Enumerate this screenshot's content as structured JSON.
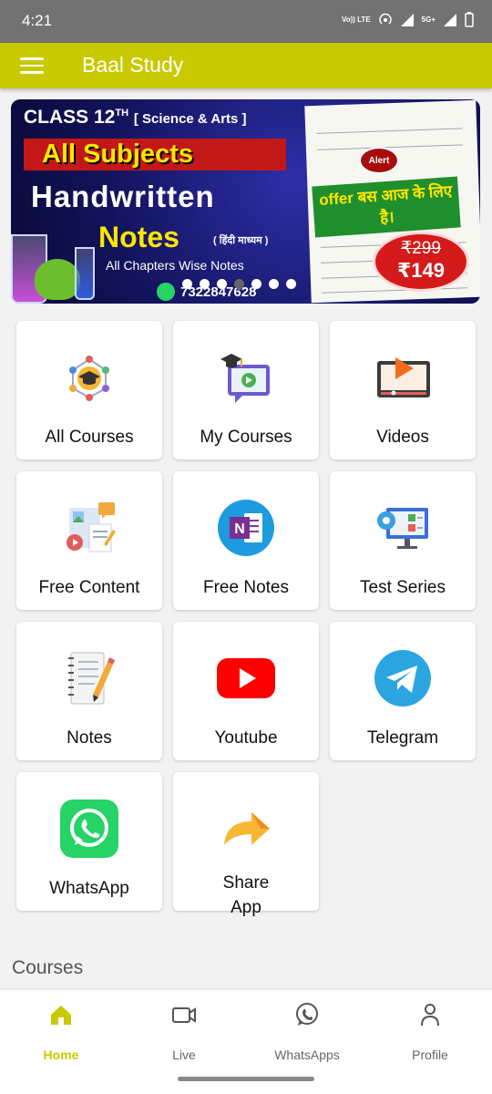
{
  "status_bar": {
    "time": "4:21",
    "volte": "Vo)) LTE",
    "network": "5G+"
  },
  "app_bar": {
    "title": "Baal Study"
  },
  "banner": {
    "class_text": "CLASS 12",
    "class_sup": "TH",
    "stream": "[ Science & Arts ]",
    "headline1": "All Subjects",
    "headline2": "Handwritten",
    "headline3": "Notes",
    "medium": "( हिंदी माध्यम )",
    "chapters": "All Chapters Wise Notes",
    "phone": "7322847628",
    "alert": "Alert",
    "offer": "offer बस आज के लिए है।",
    "old_price": "₹299",
    "new_price": "₹149",
    "dot_count": 7,
    "active_dot": 3
  },
  "tiles": [
    {
      "label": "All Courses",
      "icon": "graduation-network-icon"
    },
    {
      "label": "My Courses",
      "icon": "video-lesson-icon"
    },
    {
      "label": "Videos",
      "icon": "video-player-icon"
    },
    {
      "label": "Free Content",
      "icon": "media-content-icon"
    },
    {
      "label": "Free Notes",
      "icon": "onenote-icon"
    },
    {
      "label": "Test Series",
      "icon": "monitor-test-icon"
    },
    {
      "label": "Notes",
      "icon": "notebook-pencil-icon"
    },
    {
      "label": "Youtube",
      "icon": "youtube-icon"
    },
    {
      "label": "Telegram",
      "icon": "telegram-icon"
    },
    {
      "label": "WhatsApp",
      "icon": "whatsapp-icon"
    },
    {
      "label": "Share\nApp",
      "icon": "share-arrow-icon"
    }
  ],
  "section_title": "Courses",
  "bottom_nav": [
    {
      "label": "Home",
      "icon": "home-icon",
      "active": true
    },
    {
      "label": "Live",
      "icon": "video-camera-icon",
      "active": false
    },
    {
      "label": "WhatsApps",
      "icon": "whatsapp-icon",
      "active": false
    },
    {
      "label": "Profile",
      "icon": "person-icon",
      "active": false
    }
  ],
  "colors": {
    "accent": "#c9c900",
    "status_bar": "#727272"
  }
}
